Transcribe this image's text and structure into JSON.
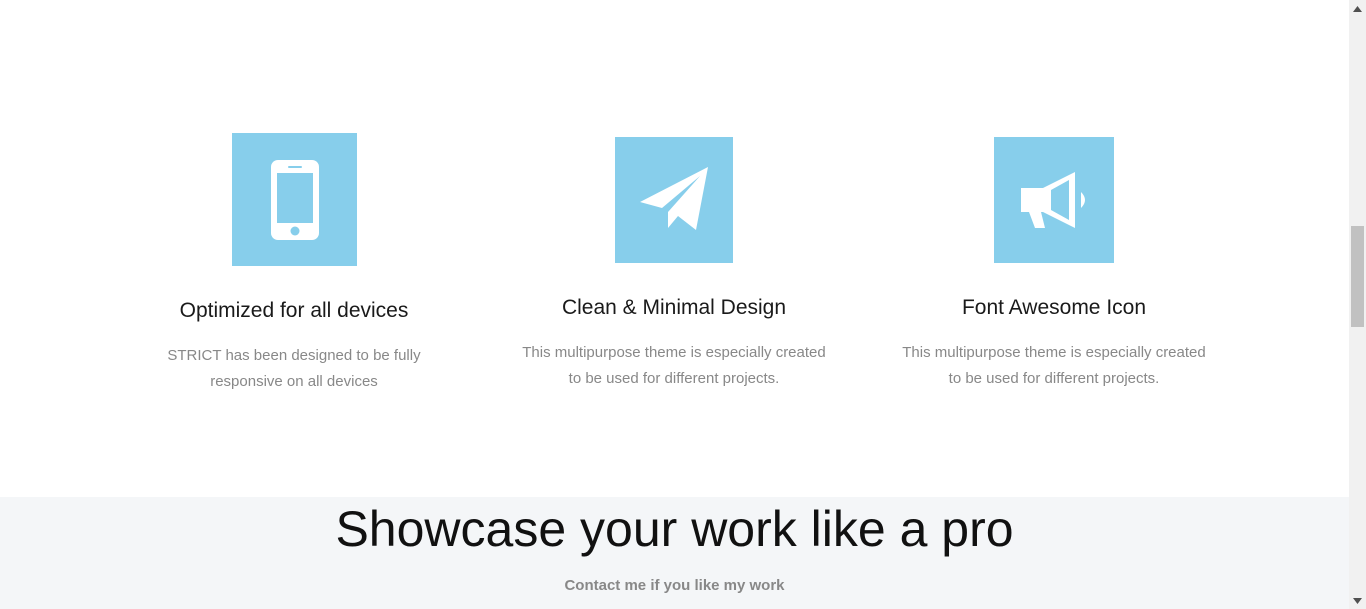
{
  "colors": {
    "icon_bg": "#87ceeb",
    "section_bg": "#f4f6f8"
  },
  "features": [
    {
      "icon": "mobile-phone-icon",
      "title": "Optimized for all devices",
      "desc_lines": [
        "STRICT has been designed to be fully",
        "responsive on all devices"
      ]
    },
    {
      "icon": "paper-plane-icon",
      "title": "Clean & Minimal Design",
      "desc_lines": [
        "This multipurpose theme is especially created",
        "to be used for different projects."
      ]
    },
    {
      "icon": "bullhorn-icon",
      "title": "Font Awesome Icon",
      "desc_lines": [
        "This multipurpose theme is especially created",
        "to be used for different projects."
      ]
    }
  ],
  "showcase": {
    "headline": "Showcase your work like a pro",
    "subtext": "Contact me if you like my work"
  }
}
